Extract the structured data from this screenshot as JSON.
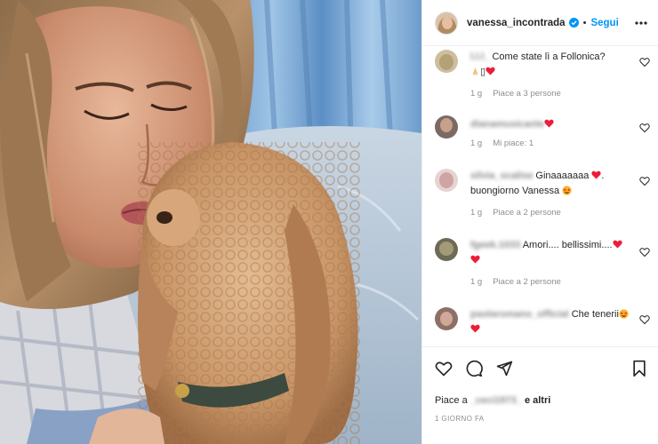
{
  "header": {
    "username": "vanessa_incontrada",
    "separator": "•",
    "follow_label": "Segui",
    "avatar_icon": "profile-avatar",
    "verified_icon": "verified-badge-icon",
    "more_icon": "more-options-icon"
  },
  "comments": [
    {
      "user": "l.l.l_",
      "text": "Come state lì a Follonica? 🙏🏻▯❤️",
      "text_main": "Come state lì a Follonica?",
      "text_tail": "▯",
      "time": "1 g",
      "likes": "Piace a 3 persone"
    },
    {
      "user": "dianamusicante",
      "text": "❤️",
      "time": "1 g",
      "likes": "Mi piace: 1"
    },
    {
      "user": "silvia_scalise",
      "text": "Ginaaaaaaa ❤️. buongiorno Vanessa 🤩",
      "text_a": "Ginaaaaaaa",
      "text_b": ".",
      "text_c": "buongiorno Vanessa",
      "time": "1 g",
      "likes": "Piace a 2 persone"
    },
    {
      "user": "fgeek.1033",
      "text": "Amori.... bellissimi....❤️ ❤️",
      "text_main": "Amori.... bellissimi....",
      "time": "1 g",
      "likes": "Piace a 2 persone"
    },
    {
      "user": "paolaromano_official",
      "text": "Che tenerii🤩 ❤️",
      "text_main": "Che tenerii",
      "time": "",
      "likes": ""
    }
  ],
  "actions": {
    "like_icon": "heart-outline-icon",
    "comment_icon": "comment-bubble-icon",
    "share_icon": "paper-plane-icon",
    "save_icon": "bookmark-icon",
    "likes_prefix": "Piace a",
    "likes_user": "_ceci1973_",
    "likes_suffix": "e altri",
    "timestamp": "1 GIORNO FA"
  },
  "colors": {
    "accent": "#0095f6",
    "heart": "#ed1d39",
    "text": "#262626",
    "secondary": "#8e8e8e"
  }
}
